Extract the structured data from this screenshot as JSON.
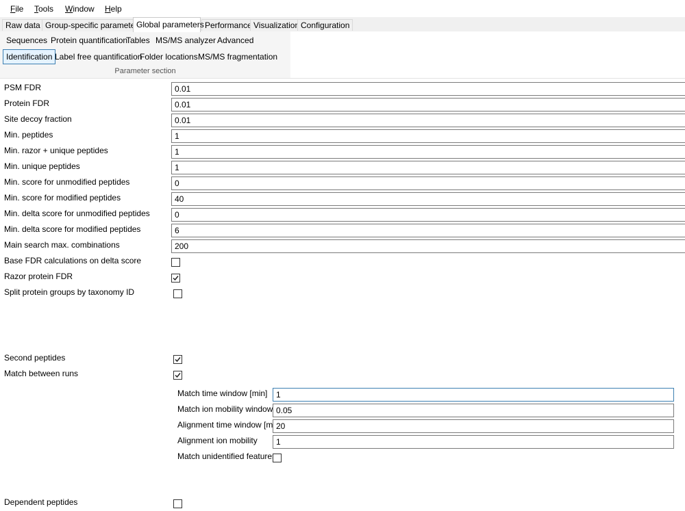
{
  "menu": [
    {
      "accel": "F",
      "rest": "ile"
    },
    {
      "accel": "T",
      "rest": "ools"
    },
    {
      "accel": "W",
      "rest": "indow"
    },
    {
      "accel": "H",
      "rest": "elp"
    }
  ],
  "tabs": [
    "Raw data",
    "Group-specific parameters",
    "Global parameters",
    "Performance",
    "Visualization",
    "Configuration"
  ],
  "ribbon": {
    "row1": [
      "Sequences",
      "Protein quantification",
      "Tables",
      "MS/MS analyzer",
      "Advanced"
    ],
    "row2": [
      "Identification",
      "Label free quantification",
      "Folder locations",
      "MS/MS fragmentation"
    ],
    "caption": "Parameter section"
  },
  "params": {
    "psm_fdr": {
      "label": "PSM FDR",
      "value": "0.01"
    },
    "protein_fdr": {
      "label": "Protein FDR",
      "value": "0.01"
    },
    "site_decoy": {
      "label": "Site decoy fraction",
      "value": "0.01"
    },
    "min_peptides": {
      "label": "Min. peptides",
      "value": "1"
    },
    "min_razor": {
      "label": "Min. razor + unique peptides",
      "value": "1"
    },
    "min_unique": {
      "label": "Min. unique peptides",
      "value": "1"
    },
    "min_score_unmod": {
      "label": "Min. score for unmodified peptides",
      "value": "0"
    },
    "min_score_mod": {
      "label": "Min. score for modified peptides",
      "value": "40"
    },
    "min_delta_unmod": {
      "label": "Min. delta score for unmodified peptides",
      "value": "0"
    },
    "min_delta_mod": {
      "label": "Min. delta score for modified peptides",
      "value": "6"
    },
    "main_search_comb": {
      "label": "Main search max. combinations",
      "value": "200"
    },
    "base_fdr_delta": {
      "label": "Base FDR calculations on delta score",
      "checked": false
    },
    "razor_protein_fdr": {
      "label": "Razor protein FDR",
      "checked": true
    },
    "split_taxonomy": {
      "label": "Split protein groups by taxonomy ID",
      "checked": false
    },
    "second_peptides": {
      "label": "Second peptides",
      "checked": true
    },
    "match_between_runs": {
      "label": "Match between runs",
      "checked": true
    },
    "dependent_peptides": {
      "label": "Dependent peptides",
      "checked": false
    }
  },
  "mbr": {
    "match_time_window": {
      "label": "Match time window [min]",
      "value": "1"
    },
    "match_ion_mobility": {
      "label": "Match ion mobility window",
      "value": "0.05"
    },
    "alignment_time_window": {
      "label": "Alignment time window [min]",
      "value": "20"
    },
    "alignment_ion_mobility": {
      "label": "Alignment ion mobility",
      "value": "1"
    },
    "match_unidentified": {
      "label": "Match unidentified features",
      "checked": false
    }
  }
}
